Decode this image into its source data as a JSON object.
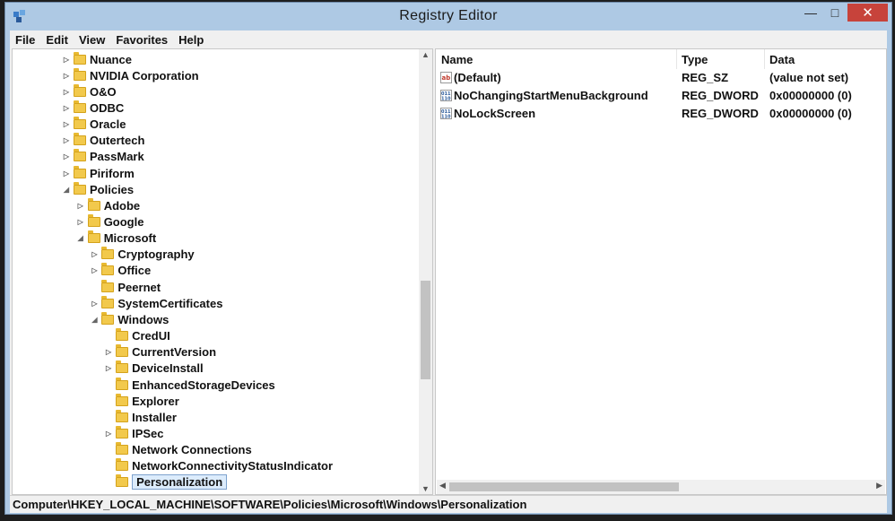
{
  "window": {
    "title": "Registry Editor"
  },
  "menu": [
    "File",
    "Edit",
    "View",
    "Favorites",
    "Help"
  ],
  "tree": [
    {
      "label": "Nuance",
      "level": 0,
      "exp": "closed"
    },
    {
      "label": "NVIDIA Corporation",
      "level": 0,
      "exp": "closed"
    },
    {
      "label": "O&O",
      "level": 0,
      "exp": "closed"
    },
    {
      "label": "ODBC",
      "level": 0,
      "exp": "closed"
    },
    {
      "label": "Oracle",
      "level": 0,
      "exp": "closed"
    },
    {
      "label": "Outertech",
      "level": 0,
      "exp": "closed"
    },
    {
      "label": "PassMark",
      "level": 0,
      "exp": "closed"
    },
    {
      "label": "Piriform",
      "level": 0,
      "exp": "closed"
    },
    {
      "label": "Policies",
      "level": 0,
      "exp": "open"
    },
    {
      "label": "Adobe",
      "level": 1,
      "exp": "closed"
    },
    {
      "label": "Google",
      "level": 1,
      "exp": "closed"
    },
    {
      "label": "Microsoft",
      "level": 1,
      "exp": "open"
    },
    {
      "label": "Cryptography",
      "level": 2,
      "exp": "closed"
    },
    {
      "label": "Office",
      "level": 2,
      "exp": "closed"
    },
    {
      "label": "Peernet",
      "level": 2,
      "exp": "none"
    },
    {
      "label": "SystemCertificates",
      "level": 2,
      "exp": "closed"
    },
    {
      "label": "Windows",
      "level": 2,
      "exp": "open"
    },
    {
      "label": "CredUI",
      "level": 3,
      "exp": "none"
    },
    {
      "label": "CurrentVersion",
      "level": 3,
      "exp": "closed"
    },
    {
      "label": "DeviceInstall",
      "level": 3,
      "exp": "closed"
    },
    {
      "label": "EnhancedStorageDevices",
      "level": 3,
      "exp": "none"
    },
    {
      "label": "Explorer",
      "level": 3,
      "exp": "none"
    },
    {
      "label": "Installer",
      "level": 3,
      "exp": "none"
    },
    {
      "label": "IPSec",
      "level": 3,
      "exp": "closed"
    },
    {
      "label": "Network Connections",
      "level": 3,
      "exp": "none"
    },
    {
      "label": "NetworkConnectivityStatusIndicator",
      "level": 3,
      "exp": "none"
    },
    {
      "label": "Personalization",
      "level": 3,
      "exp": "none",
      "selected": true
    }
  ],
  "list": {
    "headers": {
      "name": "Name",
      "type": "Type",
      "data": "Data"
    },
    "rows": [
      {
        "name": "(Default)",
        "type": "REG_SZ",
        "data": "(value not set)",
        "icon": "string-value-icon"
      },
      {
        "name": "NoChangingStartMenuBackground",
        "type": "REG_DWORD",
        "data": "0x00000000 (0)",
        "icon": "binary-value-icon"
      },
      {
        "name": "NoLockScreen",
        "type": "REG_DWORD",
        "data": "0x00000000 (0)",
        "icon": "binary-value-icon"
      }
    ]
  },
  "status": "Computer\\HKEY_LOCAL_MACHINE\\SOFTWARE\\Policies\\Microsoft\\Windows\\Personalization"
}
